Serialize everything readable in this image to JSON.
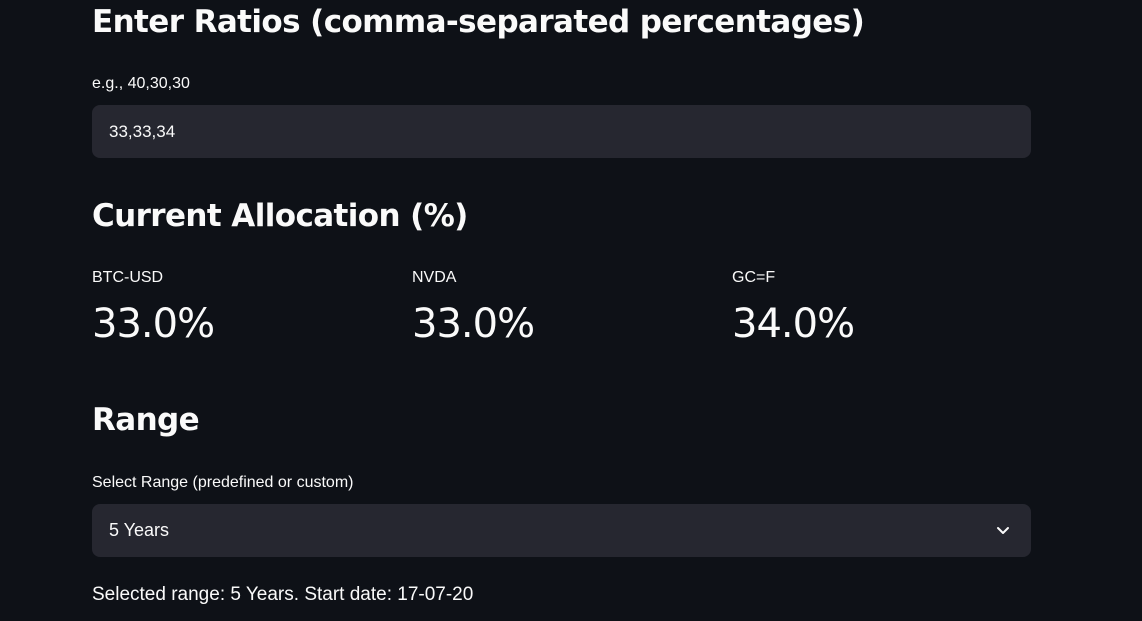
{
  "ratios": {
    "heading": "Enter Ratios (comma-separated percentages)",
    "label": "e.g., 40,30,30",
    "value": "33,33,34"
  },
  "allocation": {
    "heading": "Current Allocation (%)",
    "metrics": [
      {
        "label": "BTC-USD",
        "value": "33.0%"
      },
      {
        "label": "NVDA",
        "value": "33.0%"
      },
      {
        "label": "GC=F",
        "value": "34.0%"
      }
    ]
  },
  "range": {
    "heading": "Range",
    "label": "Select Range (predefined or custom)",
    "selected": "5 Years",
    "icon": "chevron-down-icon",
    "info": "Selected range: 5 Years. Start date: 17-07-20"
  },
  "colors": {
    "background": "#0e1117",
    "input_background": "#262730",
    "text": "#fafafa"
  }
}
